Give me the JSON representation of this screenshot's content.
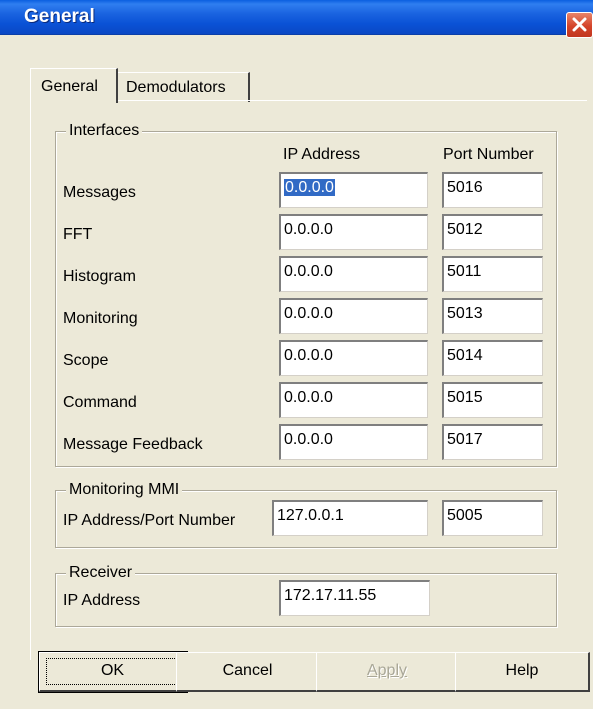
{
  "window": {
    "title": "General",
    "close_icon": "close-icon"
  },
  "tabs": [
    {
      "label": "General",
      "active": true
    },
    {
      "label": "Demodulators",
      "active": false
    }
  ],
  "interfaces": {
    "group_label": "Interfaces",
    "col_ip": "IP Address",
    "col_port": "Port Number",
    "rows": [
      {
        "label": "Messages",
        "ip": "0.0.0.0",
        "port": "5016"
      },
      {
        "label": "FFT",
        "ip": "0.0.0.0",
        "port": "5012"
      },
      {
        "label": "Histogram",
        "ip": "0.0.0.0",
        "port": "5011"
      },
      {
        "label": "Monitoring",
        "ip": "0.0.0.0",
        "port": "5013"
      },
      {
        "label": "Scope",
        "ip": "0.0.0.0",
        "port": "5014"
      },
      {
        "label": "Command",
        "ip": "0.0.0.0",
        "port": "5015"
      },
      {
        "label": "Message Feedback",
        "ip": "0.0.0.0",
        "port": "5017"
      }
    ]
  },
  "monitoring_mmi": {
    "group_label": "Monitoring MMI",
    "label": "IP Address/Port Number",
    "ip": "127.0.0.1",
    "port": "5005"
  },
  "receiver": {
    "group_label": "Receiver",
    "label": "IP Address",
    "ip": "172.17.11.55"
  },
  "buttons": {
    "ok": "OK",
    "cancel": "Cancel",
    "apply": "Apply",
    "help": "Help"
  },
  "colors": {
    "titlebar": "#0a52d6",
    "dialog_bg": "#ece9d8",
    "selection": "#316ac5",
    "close_button": "#d4442a"
  }
}
